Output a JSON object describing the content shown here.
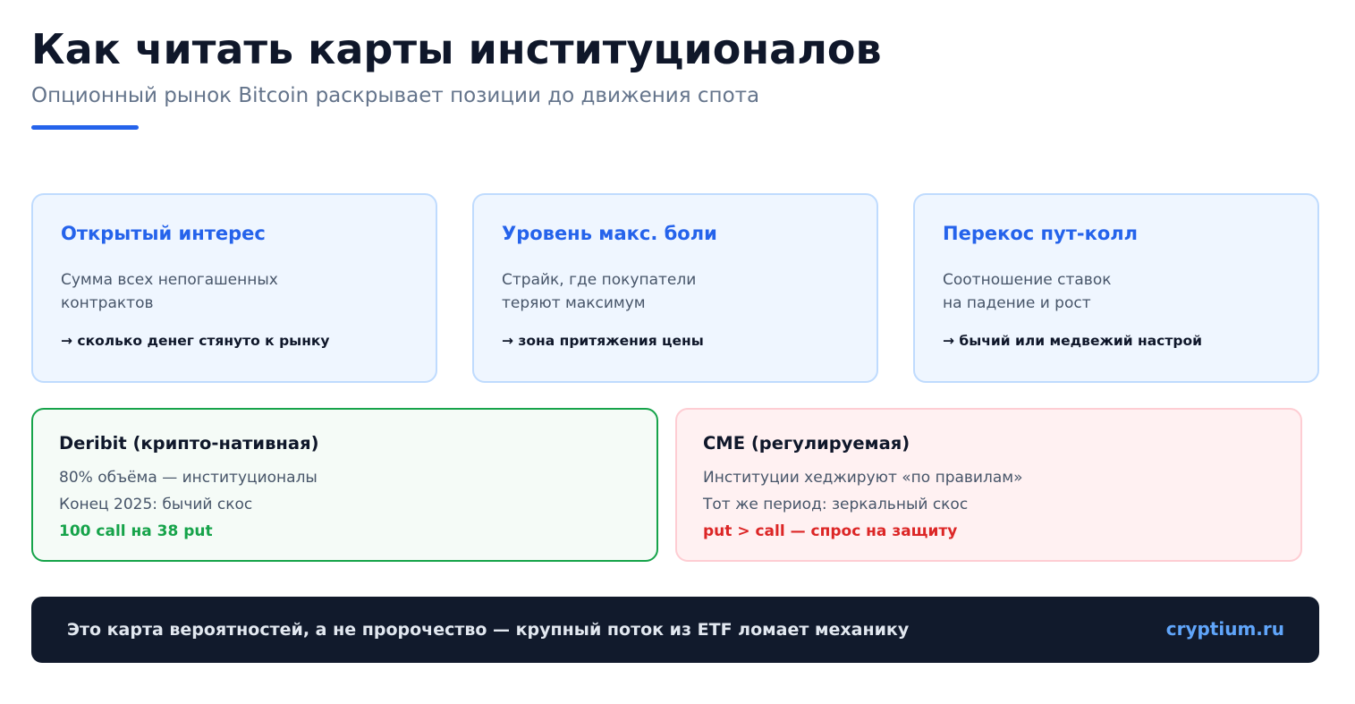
{
  "header": {
    "title": "Как читать карты институционалов",
    "subtitle": "Опционный рынок Bitcoin раскрывает позиции до движения спота"
  },
  "concepts": [
    {
      "title": "Открытый интерес",
      "desc_line1": "Сумма всех непогашенных",
      "desc_line2": "контрактов",
      "note": "→ сколько денег стянуто к рынку"
    },
    {
      "title": "Уровень макс. боли",
      "desc_line1": "Страйк, где покупатели",
      "desc_line2": "теряют максимум",
      "note": "→ зона притяжения цены"
    },
    {
      "title": "Перекос пут-колл",
      "desc_line1": "Соотношение ставок",
      "desc_line2": "на падение и рост",
      "note": "→ бычий или медвежий настрой"
    }
  ],
  "exchanges": {
    "deribit": {
      "title": "Deribit (крипто-нативная)",
      "line1": "80% объёма — институционалы",
      "line2": "Конец 2025: бычий скос",
      "highlight": "100 call на 38 put",
      "highlight_color": "#16a34a"
    },
    "cme": {
      "title": "CME (регулируемая)",
      "line1": "Институции хеджируют «по правилам»",
      "line2": "Тот же период: зеркальный скос",
      "highlight": "put > call — спрос на защиту",
      "highlight_color": "#dc2626"
    }
  },
  "footer": {
    "text": "Это карта вероятностей, а не пророчество — крупный поток из ETF ломает механику",
    "brand": "cryptium.ru"
  },
  "colors": {
    "accent": "#2563eb",
    "positive": "#16a34a",
    "negative": "#dc2626",
    "footer_bg": "#111a2c",
    "brand": "#60a5fa"
  }
}
